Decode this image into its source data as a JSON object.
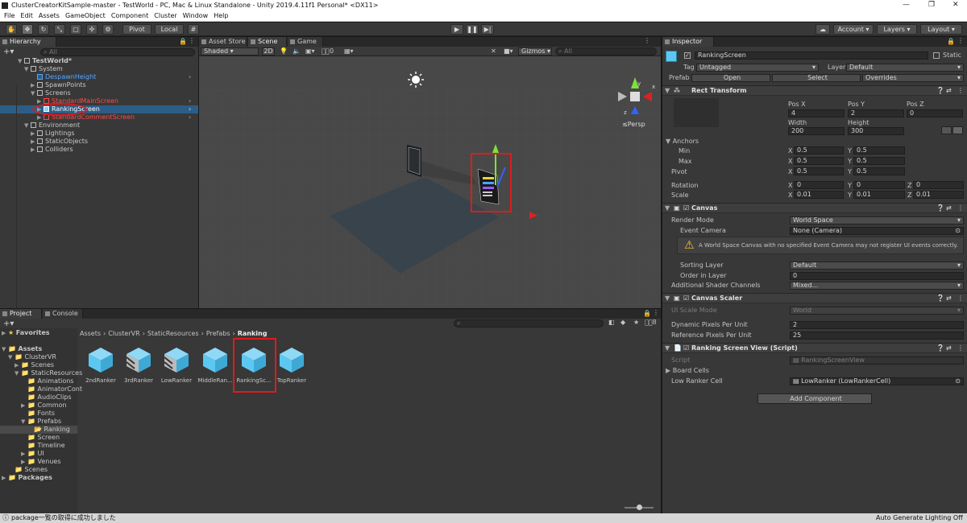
{
  "window": {
    "title": "ClusterCreatorKitSample-master - TestWorld - PC, Mac & Linux Standalone - Unity 2019.4.11f1 Personal* <DX11>",
    "controls": [
      "—",
      "❐",
      "✕"
    ]
  },
  "menu": [
    "File",
    "Edit",
    "Assets",
    "GameObject",
    "Component",
    "Cluster",
    "Window",
    "Help"
  ],
  "toolbar": {
    "pivot": "Pivot",
    "local": "Local",
    "account": "Account",
    "layers": "Layers",
    "layout": "Layout"
  },
  "hierarchy": {
    "tab": "Hierarchy",
    "search_placeholder": "All",
    "items": [
      {
        "label": "TestWorld*"
      },
      {
        "label": "System"
      },
      {
        "label": "DespawnHeight"
      },
      {
        "label": "SpawnPoints"
      },
      {
        "label": "Screens"
      },
      {
        "label": "StandardMainScreen"
      },
      {
        "label": "RankingScreen"
      },
      {
        "label": "StandardCommentScreen"
      },
      {
        "label": "Environment"
      },
      {
        "label": "Lightings"
      },
      {
        "label": "StaticObjects"
      },
      {
        "label": "Colliders"
      }
    ]
  },
  "scene": {
    "tabs": [
      "Asset Store",
      "Scene",
      "Game"
    ],
    "shading": "Shaded",
    "mode2d": "2D",
    "gizmos": "Gizmos",
    "search_placeholder": "All",
    "gizmo_x": "x",
    "gizmo_y": "y",
    "gizmo_z": "z",
    "persp": "Persp",
    "hidden_count": "0"
  },
  "inspector": {
    "tab": "Inspector",
    "object_name": "RankingScreen",
    "static": "Static",
    "tag_label": "Tag",
    "tag_value": "Untagged",
    "layer_label": "Layer",
    "layer_value": "Default",
    "prefab_label": "Prefab",
    "prefab_open": "Open",
    "prefab_select": "Select",
    "prefab_overrides": "Overrides",
    "rect": {
      "header": "Rect Transform",
      "posx_label": "Pos X",
      "posx": "4",
      "posy_label": "Pos Y",
      "posy": "2",
      "posz_label": "Pos Z",
      "posz": "0",
      "width_label": "Width",
      "width": "200",
      "height_label": "Height",
      "height": "300",
      "anchors": "Anchors",
      "min": "Min",
      "min_x": "0.5",
      "min_y": "0.5",
      "max": "Max",
      "max_x": "0.5",
      "max_y": "0.5",
      "pivot": "Pivot",
      "pivot_x": "0.5",
      "pivot_y": "0.5",
      "rotation": "Rotation",
      "rot_x": "0",
      "rot_y": "0",
      "rot_z": "0",
      "scale": "Scale",
      "scale_x": "0.01",
      "scale_y": "0.01",
      "scale_z": "0.01",
      "x": "X",
      "y": "Y",
      "z": "Z"
    },
    "canvas": {
      "header": "Canvas",
      "render_mode_label": "Render Mode",
      "render_mode": "World Space",
      "event_camera_label": "Event Camera",
      "event_camera": "None (Camera)",
      "warning": "A World Space Canvas with no specified Event Camera may not register UI events correctly.",
      "sorting_layer_label": "Sorting Layer",
      "sorting_layer": "Default",
      "order_label": "Order in Layer",
      "order": "0",
      "shader_label": "Additional Shader Channels",
      "shader": "Mixed..."
    },
    "scaler": {
      "header": "Canvas Scaler",
      "mode_label": "UI Scale Mode",
      "mode": "World",
      "dpu_label": "Dynamic Pixels Per Unit",
      "dpu": "2",
      "rppu_label": "Reference Pixels Per Unit",
      "rppu": "25"
    },
    "script": {
      "header": "Ranking Screen View (Script)",
      "script_label": "Script",
      "script_value": "RankingScreenView",
      "board_label": "Board Cells",
      "low_label": "Low Ranker Cell",
      "low_value": "LowRanker (LowRankerCell)"
    },
    "add_component": "Add Component"
  },
  "project": {
    "tabs": [
      "Project",
      "Console"
    ],
    "breadcrumb": [
      "Assets",
      "ClusterVR",
      "StaticResources",
      "Prefabs",
      "Ranking"
    ],
    "hidden_count": "8",
    "tree": [
      {
        "label": "Favorites"
      },
      {
        "label": "Assets"
      },
      {
        "label": "ClusterVR"
      },
      {
        "label": "Scenes"
      },
      {
        "label": "StaticResources"
      },
      {
        "label": "Animations"
      },
      {
        "label": "AnimatorCont"
      },
      {
        "label": "AudioClips"
      },
      {
        "label": "Common"
      },
      {
        "label": "Fonts"
      },
      {
        "label": "Prefabs"
      },
      {
        "label": "Ranking"
      },
      {
        "label": "Screen"
      },
      {
        "label": "Timeline"
      },
      {
        "label": "UI"
      },
      {
        "label": "Venues"
      },
      {
        "label": "Scenes"
      },
      {
        "label": "Packages"
      }
    ],
    "assets": [
      {
        "label": "2ndRanker"
      },
      {
        "label": "3rdRanker"
      },
      {
        "label": "LowRanker"
      },
      {
        "label": "MiddleRan..."
      },
      {
        "label": "RankingSc..."
      },
      {
        "label": "TopRanker"
      }
    ]
  },
  "status": {
    "message": "package一覧の取得に成功しました",
    "lighting": "Auto Generate Lighting Off"
  },
  "colors": {
    "selection": "#2c5d87",
    "prefab_blue": "#5cc8f2",
    "annotation_red": "#e01b1b"
  }
}
